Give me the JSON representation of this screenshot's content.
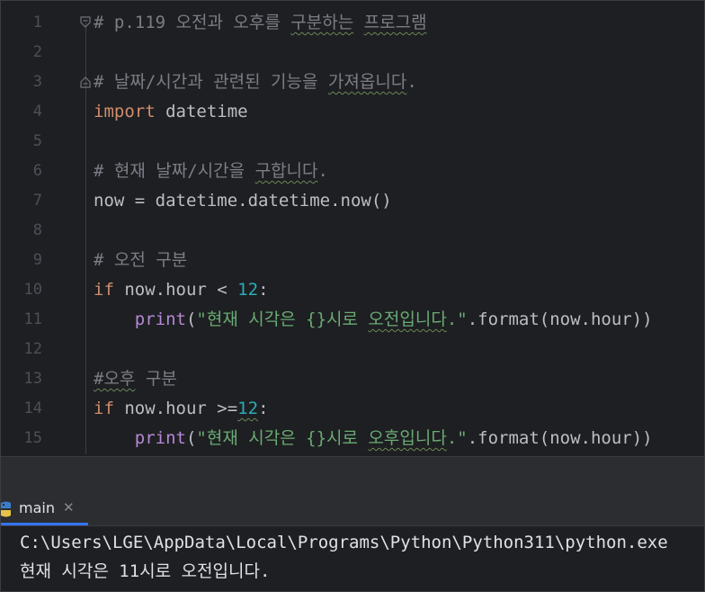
{
  "editor": {
    "line_numbers": [
      "1",
      "2",
      "3",
      "4",
      "5",
      "6",
      "7",
      "8",
      "9",
      "10",
      "11",
      "12",
      "13",
      "14",
      "15"
    ],
    "lines": [
      [
        {
          "t": "# p.119 ",
          "c": "cmt"
        },
        {
          "t": "오전과 오후를 ",
          "c": "cmt"
        },
        {
          "t": "구분하는",
          "c": "cmt typo"
        },
        {
          "t": " ",
          "c": "cmt"
        },
        {
          "t": "프로그램",
          "c": "cmt typo"
        }
      ],
      [],
      [
        {
          "t": "# 날짜/시간과 관련된 기능을 ",
          "c": "cmt"
        },
        {
          "t": "가져옵니다",
          "c": "cmt typo"
        },
        {
          "t": ".",
          "c": "cmt"
        }
      ],
      [
        {
          "t": "import",
          "c": "kw"
        },
        {
          "t": " datetime",
          "c": "plain"
        }
      ],
      [],
      [
        {
          "t": "# 현재 날짜/시간을 ",
          "c": "cmt"
        },
        {
          "t": "구합니다",
          "c": "cmt typo"
        },
        {
          "t": ".",
          "c": "cmt"
        }
      ],
      [
        {
          "t": "now = datetime.datetime.now()",
          "c": "plain"
        }
      ],
      [],
      [
        {
          "t": "# 오전 구분",
          "c": "cmt"
        }
      ],
      [
        {
          "t": "if",
          "c": "kw"
        },
        {
          "t": " now.hour < ",
          "c": "plain"
        },
        {
          "t": "12",
          "c": "num"
        },
        {
          "t": ":",
          "c": "plain"
        }
      ],
      [
        {
          "t": "    ",
          "c": "plain"
        },
        {
          "t": "print",
          "c": "fn"
        },
        {
          "t": "(",
          "c": "plain"
        },
        {
          "t": "\"현재 시각은 {}시로 ",
          "c": "str"
        },
        {
          "t": "오전입니다",
          "c": "str typo"
        },
        {
          "t": ".\"",
          "c": "str"
        },
        {
          "t": ".format(now.hour))",
          "c": "plain"
        }
      ],
      [],
      [
        {
          "t": "#오후",
          "c": "cmt typo"
        },
        {
          "t": " 구분",
          "c": "cmt"
        }
      ],
      [
        {
          "t": "if",
          "c": "kw"
        },
        {
          "t": " now.hour >=",
          "c": "plain"
        },
        {
          "t": "12",
          "c": "num typo"
        },
        {
          "t": ":",
          "c": "plain"
        }
      ],
      [
        {
          "t": "    ",
          "c": "plain"
        },
        {
          "t": "print",
          "c": "fn"
        },
        {
          "t": "(",
          "c": "plain"
        },
        {
          "t": "\"현재 시각은 {}시로 ",
          "c": "str"
        },
        {
          "t": "오후입니다",
          "c": "str typo"
        },
        {
          "t": ".\"",
          "c": "str"
        },
        {
          "t": ".format(now.hour))",
          "c": "plain"
        }
      ]
    ]
  },
  "run_panel": {
    "tab_label": "main",
    "tab_icon": "python-icon",
    "close_glyph": "✕",
    "accent_color": "#3574f0"
  },
  "console": {
    "lines": [
      "C:\\Users\\LGE\\AppData\\Local\\Programs\\Python\\Python311\\python.exe",
      "현재 시각은 11시로 오전입니다."
    ]
  }
}
